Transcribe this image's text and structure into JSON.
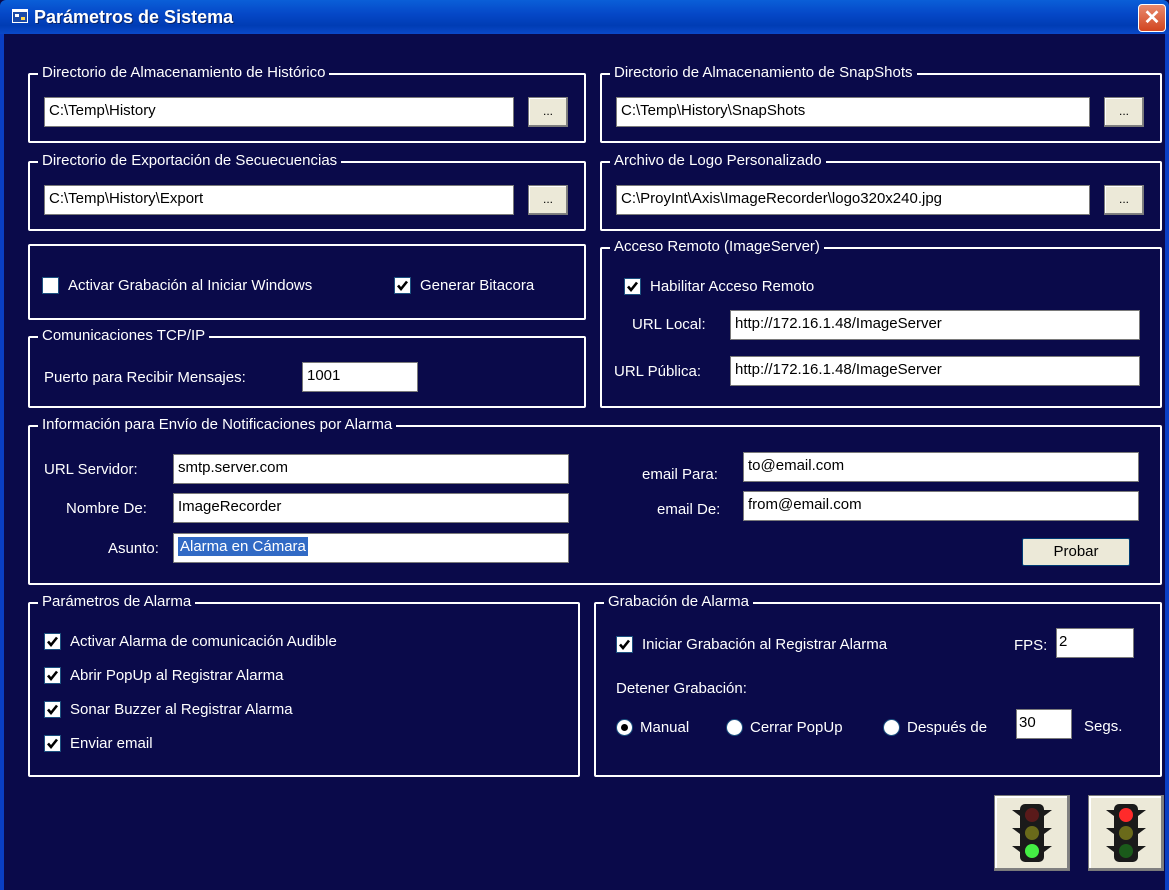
{
  "window": {
    "title": "Parámetros de Sistema",
    "close_label": "✕"
  },
  "history_dir": {
    "legend": "Directorio de Almacenamiento de Histórico",
    "value": "C:\\Temp\\History",
    "browse": "..."
  },
  "snapshots_dir": {
    "legend": "Directorio de Almacenamiento de SnapShots",
    "value": "C:\\Temp\\History\\SnapShots",
    "browse": "..."
  },
  "export_dir": {
    "legend": "Directorio de Exportación de Secuecuencias",
    "value": "C:\\Temp\\History\\Export",
    "browse": "..."
  },
  "logo_file": {
    "legend": "Archivo de Logo Personalizado",
    "value": "C:\\ProyInt\\Axis\\ImageRecorder\\logo320x240.jpg",
    "browse": "..."
  },
  "startup": {
    "activate_recording": {
      "label": "Activar Grabación al Iniciar Windows",
      "checked": false
    },
    "generate_log": {
      "label": "Generar Bitacora",
      "checked": true
    }
  },
  "remote_access": {
    "legend": "Acceso Remoto (ImageServer)",
    "enable": {
      "label": "Habilitar Acceso Remoto",
      "checked": true
    },
    "url_local_label": "URL Local:",
    "url_local_value": "http://172.16.1.48/ImageServer",
    "url_public_label": "URL Pública:",
    "url_public_value": "http://172.16.1.48/ImageServer"
  },
  "tcp": {
    "legend": "Comunicaciones TCP/IP",
    "port_label": "Puerto para Recibir Mensajes:",
    "port_value": "1001"
  },
  "notifications": {
    "legend": "Información para Envío de Notificaciones por Alarma",
    "server_label": "URL Servidor:",
    "server_value": "smtp.server.com",
    "from_name_label": "Nombre De:",
    "from_name_value": "ImageRecorder",
    "subject_label": "Asunto:",
    "subject_value": "Alarma en Cámara",
    "email_to_label": "email Para:",
    "email_to_value": "to@email.com",
    "email_from_label": "email De:",
    "email_from_value": "from@email.com",
    "test_button": "Probar"
  },
  "alarm_params": {
    "legend": "Parámetros de Alarma",
    "items": [
      {
        "label": "Activar Alarma de comunicación Audible",
        "checked": true
      },
      {
        "label": "Abrir PopUp al Registrar Alarma",
        "checked": true
      },
      {
        "label": "Sonar Buzzer al Registrar Alarma",
        "checked": true
      },
      {
        "label": "Enviar email",
        "checked": true
      }
    ]
  },
  "alarm_recording": {
    "legend": "Grabación de Alarma",
    "start": {
      "label": "Iniciar Grabación al Registrar Alarma",
      "checked": true
    },
    "fps_label": "FPS:",
    "fps_value": "2",
    "stop_label": "Detener Grabación:",
    "stop_options": [
      {
        "label": "Manual",
        "selected": true
      },
      {
        "label": "Cerrar PopUp",
        "selected": false
      },
      {
        "label": "Después de",
        "selected": false
      }
    ],
    "seconds_value": "30",
    "seconds_unit": "Segs."
  },
  "buttons": {
    "accept_icon": "traffic-light-green-icon",
    "cancel_icon": "traffic-light-red-icon"
  },
  "colors": {
    "background": "#0a0a4a",
    "titlebar": "#0548c8",
    "green_light": "#44ee44",
    "red_light": "#ff2a2a"
  }
}
